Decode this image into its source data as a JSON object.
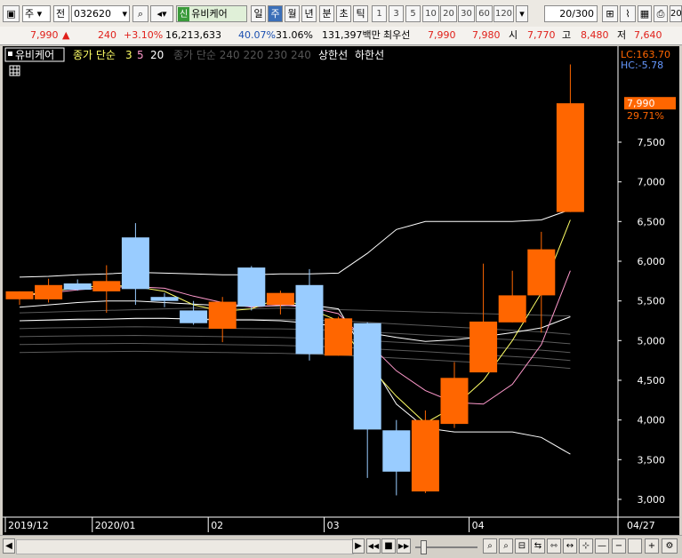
{
  "toolbar": {
    "period_select": "주",
    "market_select": "전",
    "code_value": "032620",
    "stock_badge": "신",
    "stock_name": "유비케어",
    "periods": [
      "일",
      "주",
      "월",
      "년",
      "분",
      "초",
      "틱"
    ],
    "active_period": "주",
    "numbers": [
      "1",
      "3",
      "5",
      "10",
      "20",
      "30",
      "60",
      "120"
    ],
    "count_value": "20",
    "count_total": "/300",
    "right_number": "20"
  },
  "quote": {
    "price": "7,990",
    "change": "240",
    "change_pct": "+3.10%",
    "volume": "16,213,633",
    "turnover_pct": "40.07%",
    "pct2": "31.06%",
    "amount": "131,397백만",
    "best_ask_label": "최우선",
    "best_ask": "7,990",
    "best_bid": "7,980",
    "open_label": "시",
    "open": "7,770",
    "high_label": "고",
    "high": "8,480",
    "low_label": "저",
    "low": "7,640"
  },
  "colors": {
    "up": "#ff6600",
    "down": "#99ccff",
    "ma3": "#ffff66",
    "ma5": "#ff99cc",
    "ma20": "#ffffff",
    "ma_long": "#888888",
    "envelope": "#ffffff",
    "price_tag": "#ff6600"
  },
  "chart_data": {
    "type": "candlestick",
    "legend": {
      "name": "유비케어",
      "ma_label": "종가 단순",
      "ma_periods": [
        "3",
        "5",
        "20"
      ],
      "ma_long_label": "종가 단순 240 220 230 240",
      "envelope_upper": "상한선",
      "envelope_lower": "하한선"
    },
    "lc_label": "LC:163.70",
    "hc_label": "HC:-5.78",
    "last_price_tag": "7,990",
    "last_pct_tag": "29.71%",
    "yticks": [
      "7,500",
      "7,000",
      "6,500",
      "6,000",
      "5,500",
      "5,000",
      "4,500",
      "4,000",
      "3,500",
      "3,000"
    ],
    "ytick_values": [
      7500,
      7000,
      6500,
      6000,
      5500,
      5000,
      4500,
      4000,
      3500,
      3000
    ],
    "ylim": [
      2800,
      8800
    ],
    "xticks": [
      {
        "label": "2019/12",
        "index": 0
      },
      {
        "label": "2020/01",
        "index": 3
      },
      {
        "label": "02",
        "index": 7
      },
      {
        "label": "03",
        "index": 11
      },
      {
        "label": "04",
        "index": 16
      }
    ],
    "last_date_label": "04/27",
    "candles": [
      {
        "o": 5520,
        "h": 5620,
        "l": 5450,
        "c": 5620
      },
      {
        "o": 5520,
        "h": 5780,
        "l": 5480,
        "c": 5700
      },
      {
        "o": 5720,
        "h": 5770,
        "l": 5630,
        "c": 5640
      },
      {
        "o": 5620,
        "h": 5950,
        "l": 5350,
        "c": 5750
      },
      {
        "o": 6300,
        "h": 6480,
        "l": 5450,
        "c": 5650
      },
      {
        "o": 5550,
        "h": 5600,
        "l": 5420,
        "c": 5500
      },
      {
        "o": 5380,
        "h": 5500,
        "l": 5200,
        "c": 5220
      },
      {
        "o": 5150,
        "h": 5550,
        "l": 4980,
        "c": 5490
      },
      {
        "o": 5920,
        "h": 5940,
        "l": 5380,
        "c": 5430
      },
      {
        "o": 5450,
        "h": 5630,
        "l": 5330,
        "c": 5600
      },
      {
        "o": 5700,
        "h": 5900,
        "l": 4750,
        "c": 4830
      },
      {
        "o": 4810,
        "h": 5300,
        "l": 4810,
        "c": 5280
      },
      {
        "o": 5220,
        "h": 5230,
        "l": 3270,
        "c": 3880
      },
      {
        "o": 3870,
        "h": 4000,
        "l": 3050,
        "c": 3350
      },
      {
        "o": 3100,
        "h": 4120,
        "l": 3080,
        "c": 4000
      },
      {
        "o": 3950,
        "h": 4730,
        "l": 3900,
        "c": 4530
      },
      {
        "o": 4600,
        "h": 5970,
        "l": 4600,
        "c": 5240
      },
      {
        "o": 5230,
        "h": 5880,
        "l": 5230,
        "c": 5570
      },
      {
        "o": 5570,
        "h": 6370,
        "l": 5100,
        "c": 6150
      },
      {
        "o": 6620,
        "h": 8480,
        "l": 6620,
        "c": 7990
      }
    ],
    "ma3": [
      5560,
      5620,
      5660,
      5700,
      5680,
      5620,
      5450,
      5370,
      5400,
      5540,
      5400,
      5250,
      4700,
      4300,
      3960,
      4170,
      4500,
      5000,
      5600,
      6520
    ],
    "ma5": [
      5560,
      5600,
      5640,
      5670,
      5680,
      5660,
      5560,
      5480,
      5420,
      5450,
      5420,
      5340,
      4980,
      4620,
      4370,
      4220,
      4200,
      4450,
      4950,
      5880
    ],
    "ma20": [
      5250,
      5260,
      5270,
      5270,
      5280,
      5280,
      5270,
      5260,
      5260,
      5250,
      5220,
      5180,
      5100,
      5040,
      4990,
      5010,
      5050,
      5100,
      5160,
      5300
    ],
    "env_upper": [
      5800,
      5810,
      5830,
      5840,
      5860,
      5850,
      5840,
      5830,
      5830,
      5840,
      5840,
      5850,
      6100,
      6400,
      6500,
      6500,
      6500,
      6500,
      6520,
      6650
    ],
    "env_lower": [
      5420,
      5450,
      5480,
      5500,
      5500,
      5480,
      5460,
      5440,
      5430,
      5440,
      5450,
      5400,
      4800,
      4200,
      3900,
      3850,
      3850,
      3850,
      3780,
      3570
    ]
  },
  "bottom": {
    "arrow_left": "◀",
    "arrow_right": "▶",
    "btn_prev": "◀◀",
    "btn_stop": "■",
    "btn_next": "▶▶",
    "zoom_minus": "−",
    "zoom_plus": "+",
    "zoom_reset": "—"
  }
}
